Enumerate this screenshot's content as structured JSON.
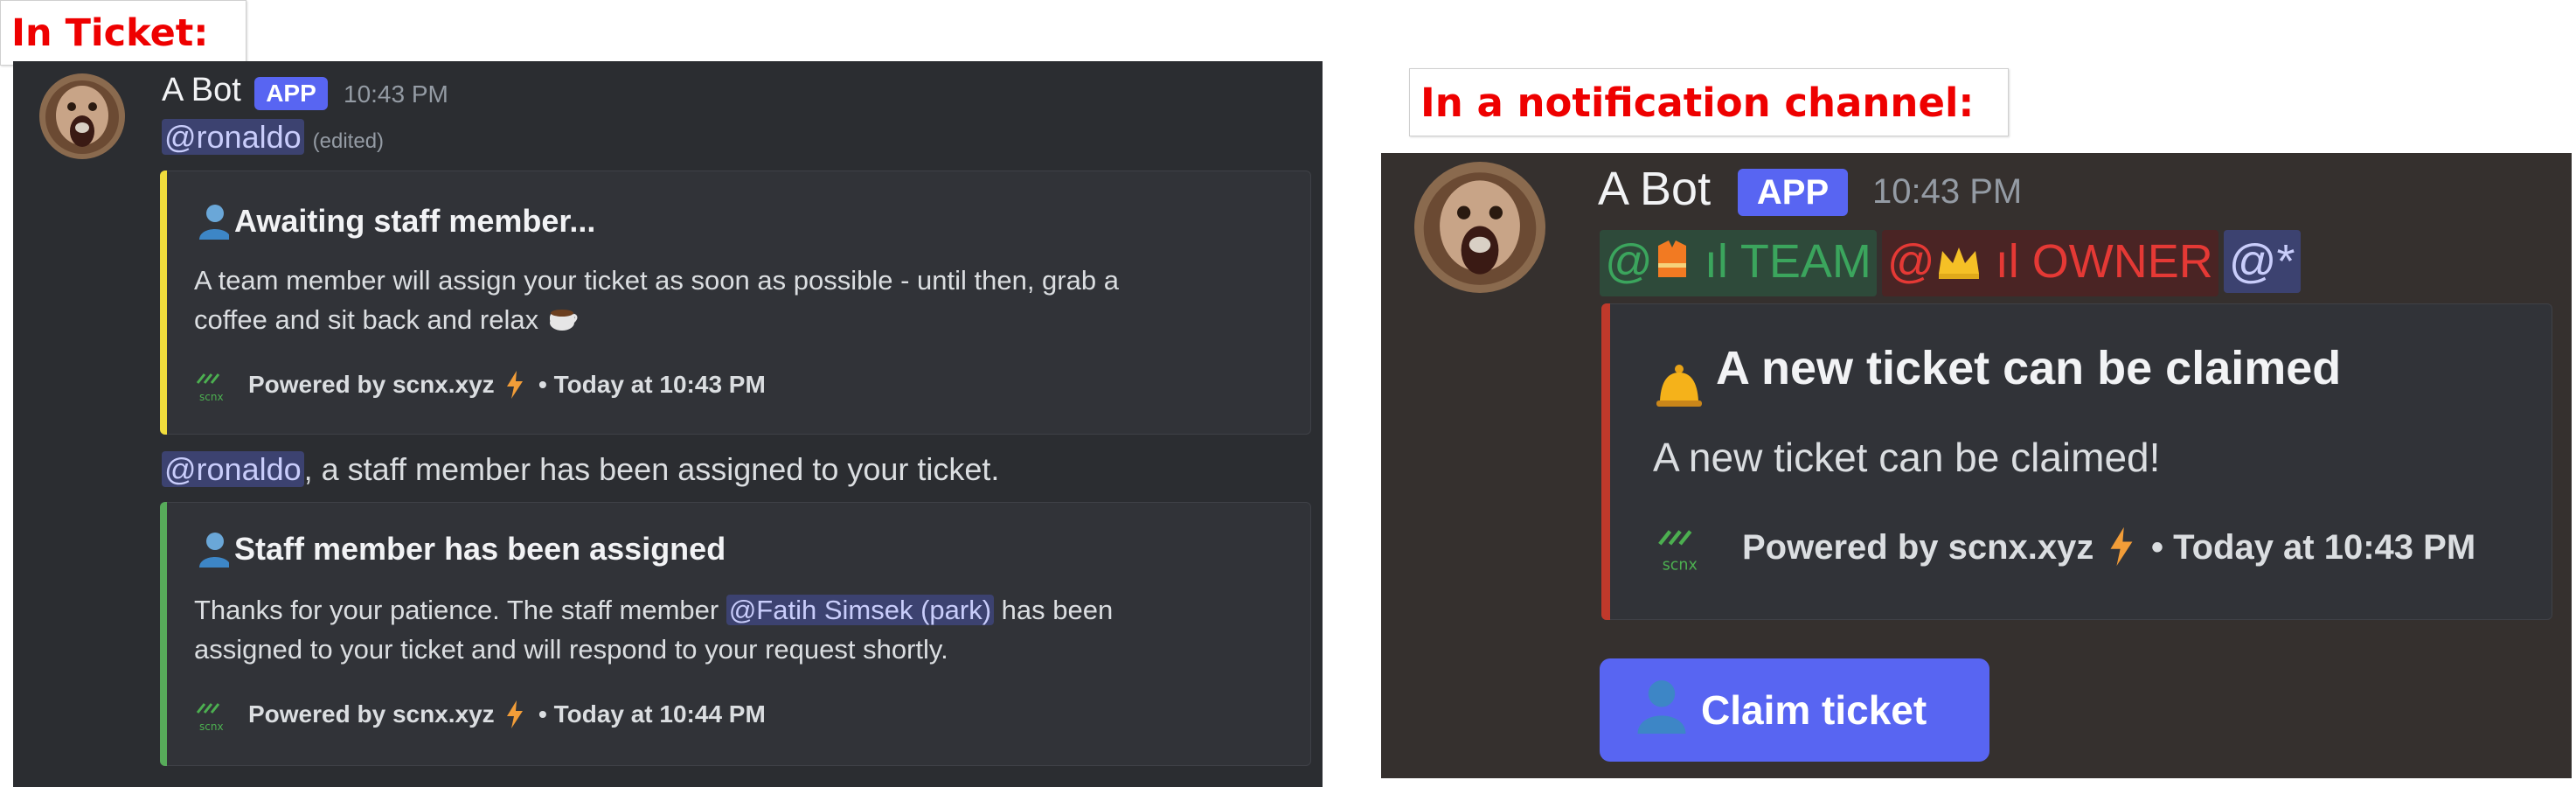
{
  "labels": {
    "in_ticket": "In Ticket:",
    "notification": "In a notification channel:"
  },
  "ticket": {
    "bot_name": "A Bot",
    "app_badge": "APP",
    "time": "10:43 PM",
    "mention": "@ronaldo",
    "edited": "(edited)",
    "embed1": {
      "title": "Awaiting staff member...",
      "description_line1": "A team member will assign your ticket as soon as possible - until then, grab a",
      "description_line2": "coffee and sit back and relax",
      "footer": "Powered by scnx.xyz",
      "footer_time": "• Today at 10:43 PM",
      "accent": "#f0dc3c"
    },
    "message2_mention": "@ronaldo",
    "message2_text": ", a staff member has been assigned to your ticket.",
    "embed2": {
      "title": "Staff member has been assigned",
      "description_pre": "Thanks for your patience. The staff member",
      "description_mention": "@Fatih Simsek (park)",
      "description_post": "has been",
      "description_line2": "assigned to your ticket and will respond to your request shortly.",
      "footer": "Powered by scnx.xyz",
      "footer_time": "• Today at 10:44 PM",
      "accent": "#57ab5a"
    }
  },
  "notification": {
    "bot_name": "A Bot",
    "app_badge": "APP",
    "time": "10:43 PM",
    "roles": [
      {
        "prefix": "@",
        "name": "ıl TEAM",
        "color": "#3ba55d"
      },
      {
        "prefix": "@",
        "name": "ıl OWNER",
        "color": "#e53935"
      },
      {
        "prefix": "@*",
        "name": "",
        "color": "#c9cdfb"
      }
    ],
    "embed": {
      "title": "A new ticket can be claimed",
      "description": "A new ticket can be claimed!",
      "footer": "Powered by scnx.xyz",
      "footer_time": "• Today at 10:43 PM",
      "accent": "#c0392b"
    },
    "button_label": "Claim ticket"
  },
  "icons": {
    "avatar": "monkey-avatar",
    "title_icon": "person-icon",
    "bell": "bell-icon",
    "coffee": "coffee-icon",
    "bolt": "lightning-icon",
    "scnx_logo": "scnx-logo"
  },
  "logo_text": "scnx"
}
